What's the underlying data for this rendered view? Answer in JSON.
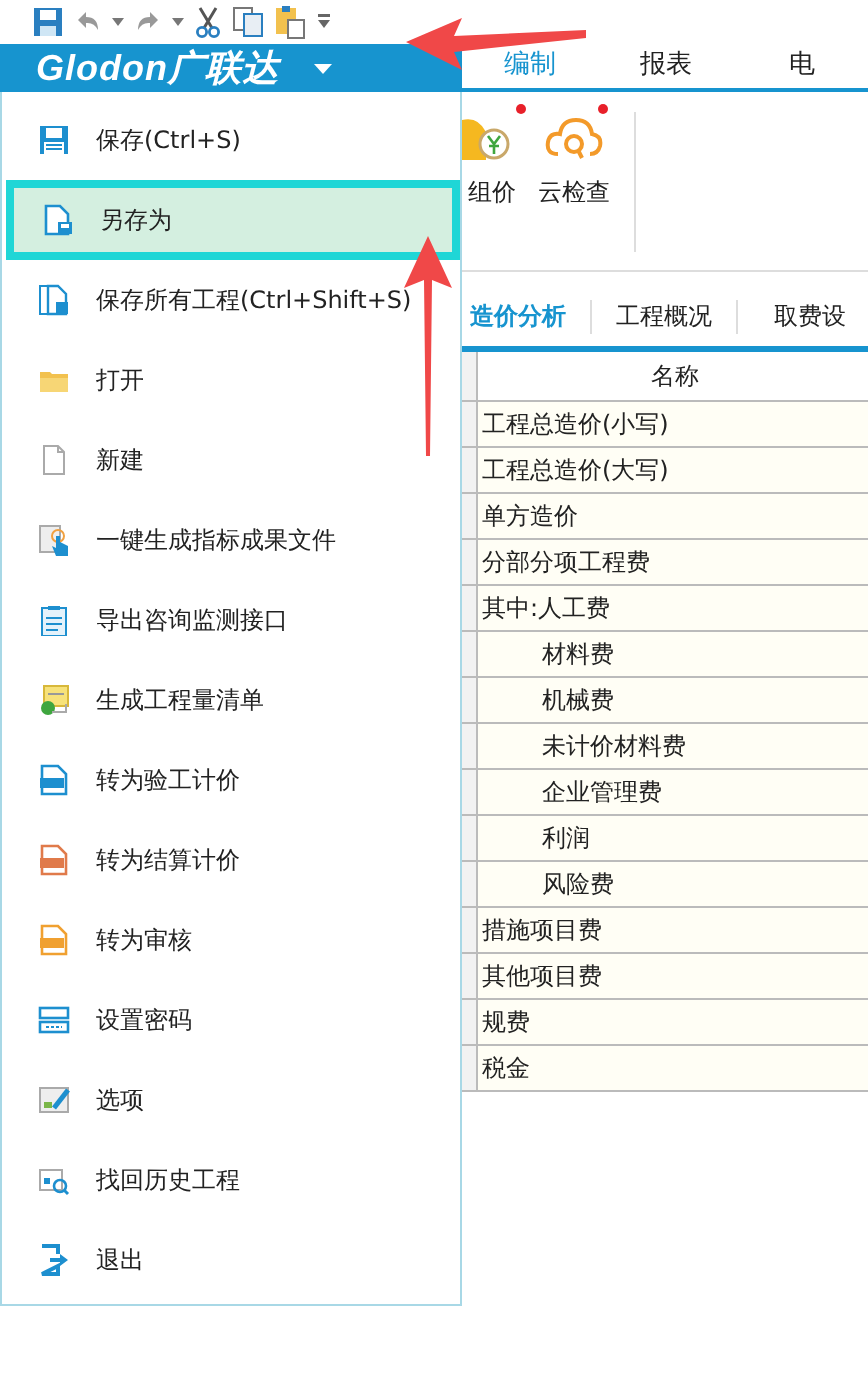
{
  "logo": "Glodon广联达",
  "ribbon_tabs": [
    {
      "label": "编制",
      "selected": true
    },
    {
      "label": "报表",
      "selected": false
    },
    {
      "label": "电",
      "selected": false
    }
  ],
  "ribbon_buttons": [
    {
      "label": "组价",
      "kind": "price",
      "badge": true
    },
    {
      "label": "云检查",
      "kind": "cloud",
      "badge": true
    }
  ],
  "menu": [
    {
      "label": "保存(Ctrl+S)",
      "kind": "save",
      "selected": false
    },
    {
      "label": "另存为",
      "kind": "saveas",
      "selected": true
    },
    {
      "label": "保存所有工程(Ctrl+Shift+S)",
      "kind": "saveall",
      "selected": false
    },
    {
      "label": "打开",
      "kind": "open",
      "selected": false
    },
    {
      "label": "新建",
      "kind": "new",
      "selected": false
    },
    {
      "label": "一键生成指标成果文件",
      "kind": "touch",
      "selected": false
    },
    {
      "label": "导出咨询监测接口",
      "kind": "export",
      "selected": false
    },
    {
      "label": "生成工程量清单",
      "kind": "list",
      "selected": false
    },
    {
      "label": "转为验工计价",
      "kind": "gpv",
      "selected": false
    },
    {
      "label": "转为结算计价",
      "kind": "gsc",
      "selected": false
    },
    {
      "label": "转为审核",
      "kind": "gsh",
      "selected": false
    },
    {
      "label": "设置密码",
      "kind": "password",
      "selected": false
    },
    {
      "label": "选项",
      "kind": "options",
      "selected": false
    },
    {
      "label": "找回历史工程",
      "kind": "history",
      "selected": false
    },
    {
      "label": "退出",
      "kind": "exit",
      "selected": false
    }
  ],
  "doc_tabs": [
    {
      "label": "造价分析",
      "selected": true
    },
    {
      "label": "工程概况",
      "selected": false
    },
    {
      "label": "取费设",
      "selected": false
    }
  ],
  "table": {
    "columns": [
      "名称"
    ],
    "rows": [
      {
        "name": "工程总造价(小写)"
      },
      {
        "name": "工程总造价(大写)"
      },
      {
        "name": "单方造价"
      },
      {
        "name": "分部分项工程费"
      },
      {
        "name": "其中:人工费",
        "children": [
          {
            "name": "材料费"
          },
          {
            "name": "机械费"
          },
          {
            "name": "未计价材料费"
          },
          {
            "name": "企业管理费"
          },
          {
            "name": "利润"
          },
          {
            "name": "风险费"
          }
        ]
      },
      {
        "name": "措施项目费"
      },
      {
        "name": "其他项目费"
      },
      {
        "name": "规费"
      },
      {
        "name": "税金"
      }
    ]
  }
}
